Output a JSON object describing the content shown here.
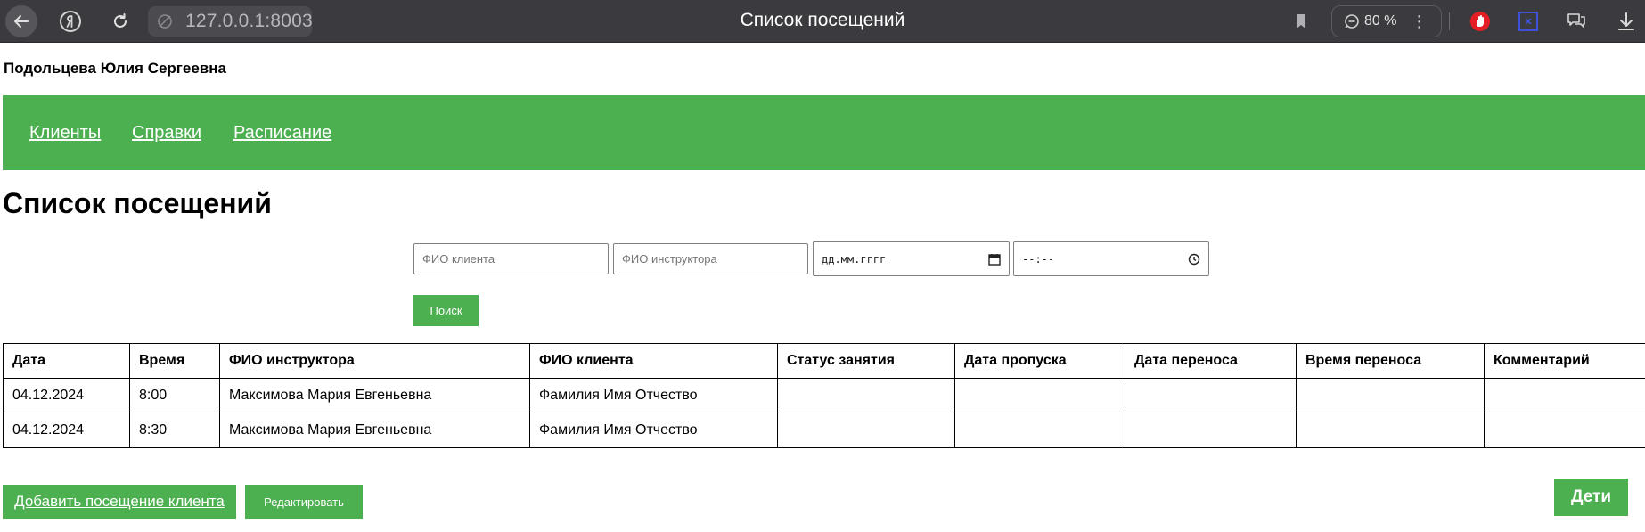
{
  "browser": {
    "url": "127.0.0.1:8003",
    "tab_title": "Список посещений",
    "zoom": "80 %"
  },
  "page": {
    "user_name": "Подольцева Юлия Сергеевна",
    "nav": [
      "Клиенты",
      "Справки",
      "Расписание"
    ],
    "title": "Список посещений"
  },
  "filters": {
    "client_placeholder": "ФИО клиента",
    "instructor_placeholder": "ФИО инструктора",
    "date_placeholder": "дд.мм.гггг",
    "time_placeholder": "--:--",
    "search_label": "Поиск"
  },
  "table": {
    "headers": [
      "Дата",
      "Время",
      "ФИО инструктора",
      "ФИО клиента",
      "Статус занятия",
      "Дата пропуска",
      "Дата переноса",
      "Время переноса",
      "Комментарий"
    ],
    "rows": [
      [
        "04.12.2024",
        "8:00",
        "Максимова Мария Евгеньевна",
        "Фамилия Имя Отчество",
        "",
        "",
        "",
        "",
        ""
      ],
      [
        "04.12.2024",
        "8:30",
        "Максимова Мария Евгеньевна",
        "Фамилия Имя Отчество",
        "",
        "",
        "",
        "",
        ""
      ]
    ]
  },
  "actions": {
    "add_label": "Добавить посещение клиента",
    "edit_label": "Редактировать",
    "kids_label": "Дети"
  },
  "colors": {
    "accent": "#4caf50",
    "browser_bar": "#3b3b3f"
  }
}
